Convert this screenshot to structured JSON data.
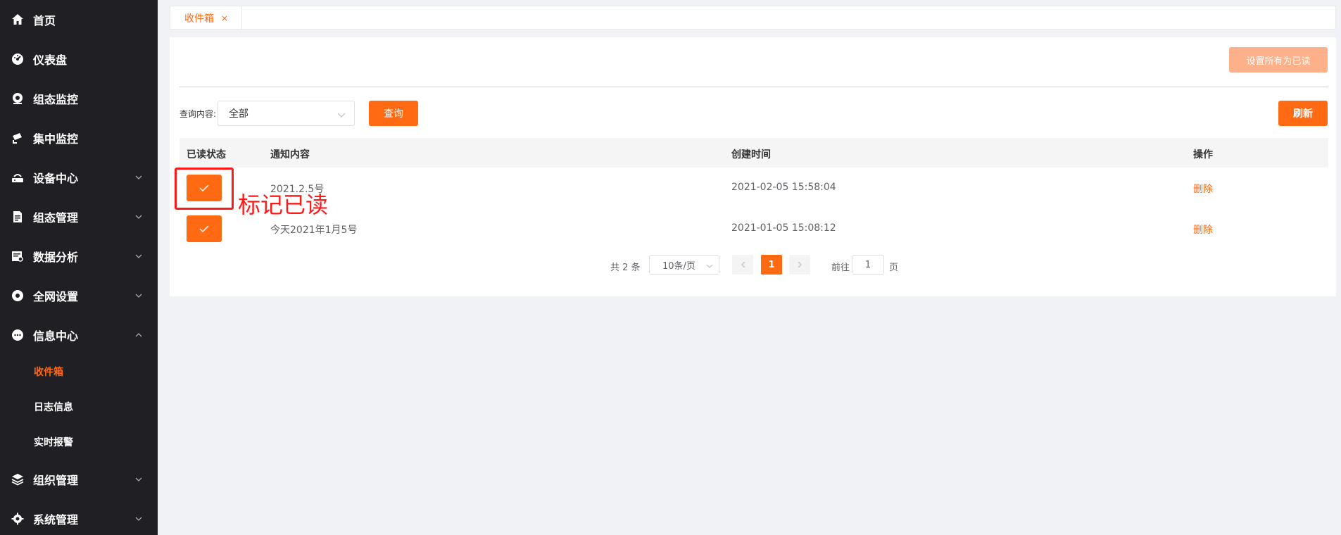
{
  "sidebar": {
    "items": [
      {
        "label": "首页",
        "icon": "home-icon"
      },
      {
        "label": "仪表盘",
        "icon": "dashboard-icon"
      },
      {
        "label": "组态监控",
        "icon": "camera-icon"
      },
      {
        "label": "集中监控",
        "icon": "cctv-icon"
      },
      {
        "label": "设备中心",
        "icon": "router-icon"
      },
      {
        "label": "组态管理",
        "icon": "document-icon"
      },
      {
        "label": "数据分析",
        "icon": "analytics-icon"
      },
      {
        "label": "全网设置",
        "icon": "network-icon"
      },
      {
        "label": "信息中心",
        "icon": "chat-icon"
      },
      {
        "label": "组织管理",
        "icon": "layers-icon"
      },
      {
        "label": "系统管理",
        "icon": "gear-icon"
      }
    ],
    "sub_items": [
      {
        "label": "收件箱",
        "active": true
      },
      {
        "label": "日志信息",
        "active": false
      },
      {
        "label": "实时报警",
        "active": false
      }
    ]
  },
  "tabs": [
    {
      "label": "收件箱",
      "close": "×"
    }
  ],
  "toolbar": {
    "mark_all_label": "设置所有为已读",
    "query_label": "查询内容:",
    "query_value": "全部",
    "query_button": "查询",
    "refresh_button": "刷新"
  },
  "table": {
    "headers": [
      "已读状态",
      "通知内容",
      "创建时间",
      "操作"
    ],
    "rows": [
      {
        "content": "2021.2.5号",
        "time": "2021-02-05 15:58:04",
        "action": "删除"
      },
      {
        "content": "今天2021年1月5号",
        "time": "2021-01-05 15:08:12",
        "action": "删除"
      }
    ]
  },
  "annotation": {
    "text": "标记已读"
  },
  "pagination": {
    "total": "共 2 条",
    "page_size": "10条/页",
    "current_page": "1",
    "goto_label": "前往",
    "goto_value": "1",
    "page_suffix": "页"
  },
  "colors": {
    "accent": "#ff6a13",
    "sidebar_bg": "#1f1f24",
    "annotation": "#ff1a1a"
  }
}
